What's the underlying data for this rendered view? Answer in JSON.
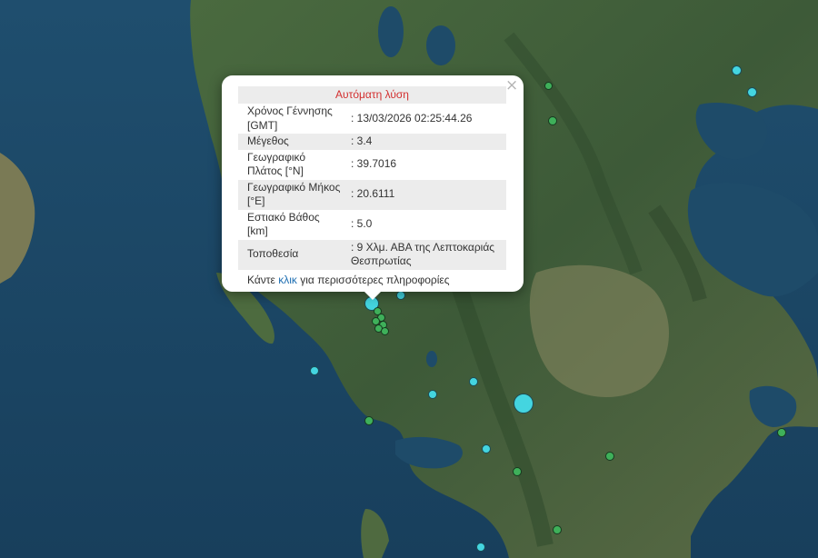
{
  "colors": {
    "sea": "#1d4a6b",
    "land": "#3e5d3a",
    "popup_title": "#d32f2f",
    "link": "#1f6fb2",
    "recent_quake": "#44d5e0",
    "older_quake": "#3fb05a"
  },
  "popup": {
    "title": "Αυτόματη λύση",
    "close_icon": "×",
    "rows": [
      {
        "label": "Χρόνος Γέννησης [GMT]",
        "value": ": 13/03/2026 02:25:44.26"
      },
      {
        "label": "Μέγεθος",
        "value": ": 3.4"
      },
      {
        "label": "Γεωγραφικό Πλάτος [°N]",
        "value": ": 39.7016"
      },
      {
        "label": "Γεωγραφικό Μήκος [°E]",
        "value": ": 20.6111"
      },
      {
        "label": "Εστιακό Βάθος [km]",
        "value": ": 5.0"
      },
      {
        "label": "Τοποθεσία",
        "value": ": 9 Χλμ. ΑΒΑ της Λεπτοκαριάς Θεσπρωτίας"
      }
    ],
    "more_prefix": "Κάντε",
    "more_link": "κλικ",
    "more_suffix": "για περισσότερες πληροφορίες"
  }
}
